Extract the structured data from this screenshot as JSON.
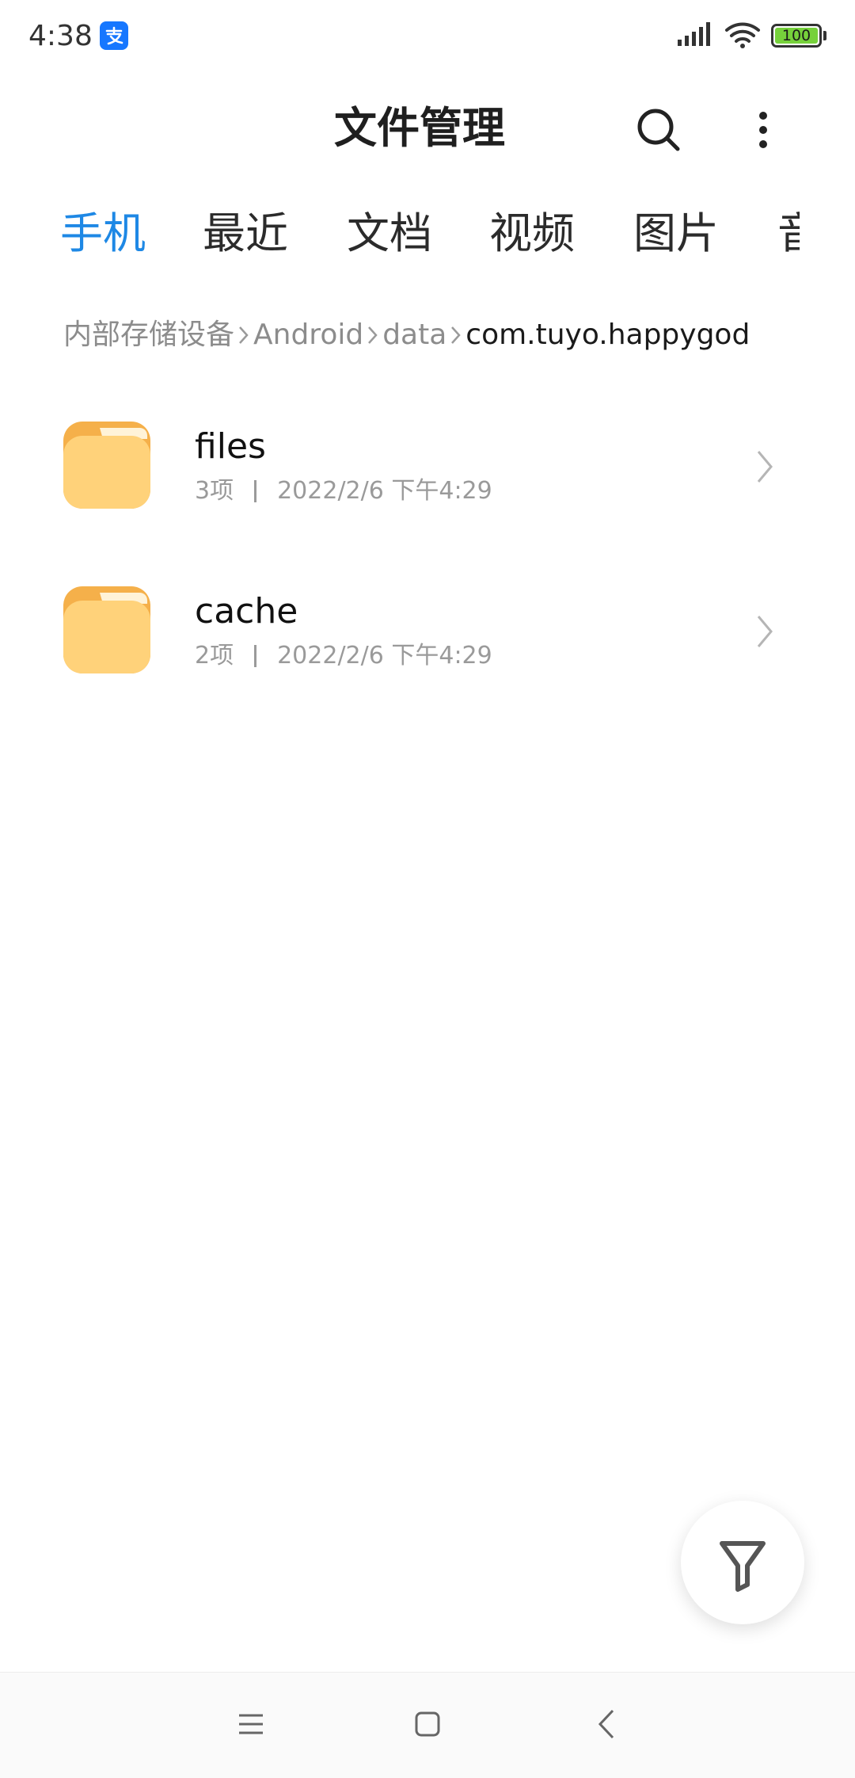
{
  "status_bar": {
    "time": "4:38",
    "battery": "100",
    "app_icon": "alipay-icon"
  },
  "header": {
    "title": "文件管理",
    "search_icon": "search-icon",
    "more_icon": "more-vertical-icon"
  },
  "tabs": [
    {
      "label": "手机",
      "active": true
    },
    {
      "label": "最近",
      "active": false
    },
    {
      "label": "文档",
      "active": false
    },
    {
      "label": "视频",
      "active": false
    },
    {
      "label": "图片",
      "active": false
    },
    {
      "label": "音",
      "active": false
    }
  ],
  "breadcrumb": [
    {
      "label": "内部存储设备"
    },
    {
      "label": "Android"
    },
    {
      "label": "data"
    },
    {
      "label": "com.tuyo.happygod",
      "current": true
    }
  ],
  "files": [
    {
      "name": "files",
      "count": "3项",
      "date": "2022/2/6 下午4:29"
    },
    {
      "name": "cache",
      "count": "2项",
      "date": "2022/2/6 下午4:29"
    }
  ],
  "fab": {
    "icon": "filter-icon"
  },
  "nav": {
    "menu_icon": "menu-icon",
    "home_icon": "home-icon",
    "back_icon": "back-icon"
  },
  "colors": {
    "accent": "#1e88e5",
    "folder": "#ffd27a",
    "folder_tab": "#f5b04a"
  }
}
